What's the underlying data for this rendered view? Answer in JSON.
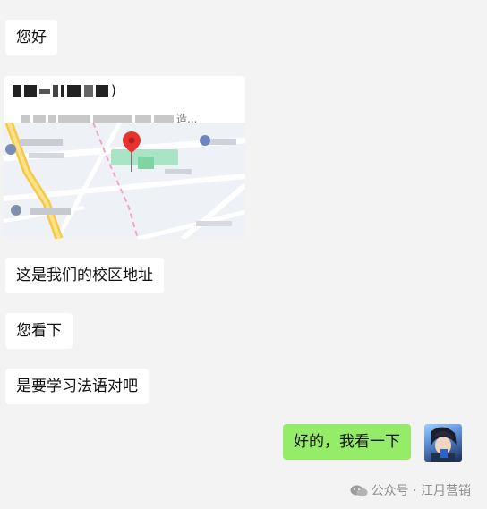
{
  "messages": [
    {
      "text": "您好",
      "sender": "contact"
    },
    {
      "text": "这是我们的校区地址",
      "sender": "contact"
    },
    {
      "text": "您看下",
      "sender": "contact"
    },
    {
      "text": "是要学习法语对吧",
      "sender": "contact"
    },
    {
      "text": "好的，我看一下",
      "sender": "me"
    }
  ],
  "location_card": {
    "title_suffix": ")",
    "address_suffix": "造..."
  },
  "watermark": {
    "text": "公众号 · 江月营销"
  },
  "colors": {
    "background": "#f3f3f3",
    "incoming_bubble": "#ffffff",
    "outgoing_bubble": "#95ec69",
    "map_pin": "#e8322d"
  }
}
